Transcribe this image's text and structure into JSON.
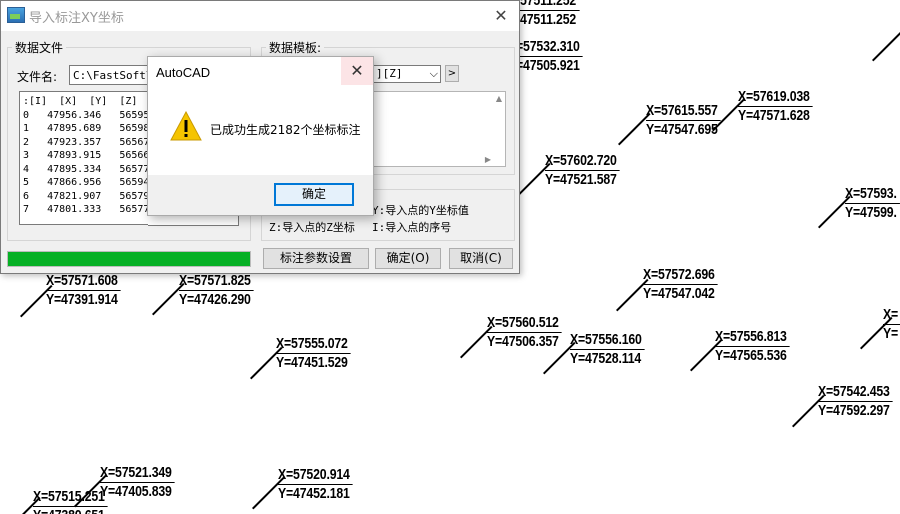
{
  "annotations": [
    {
      "x": "X=57511.252",
      "y": "Y=47511.252"
    },
    {
      "x": "X=57532.310",
      "y": "Y=47505.921"
    },
    {
      "x": "X=57615.557",
      "y": "Y=47547.695"
    },
    {
      "x": "X=57619.038",
      "y": "Y=47571.628"
    },
    {
      "x": "X=57602.720",
      "y": "Y=47521.587"
    },
    {
      "x": "X=57593.",
      "y": "Y=47599."
    },
    {
      "x": "X=57571.608",
      "y": "Y=47391.914"
    },
    {
      "x": "X=57571.825",
      "y": "Y=47426.290"
    },
    {
      "x": "X=57572.696",
      "y": "Y=47547.042"
    },
    {
      "x": "X=57560.512",
      "y": "Y=47506.357"
    },
    {
      "x": "X=57556.160",
      "y": "Y=47528.114"
    },
    {
      "x": "X=57556.813",
      "y": "Y=47565.536"
    },
    {
      "x": "X=",
      "y": "Y="
    },
    {
      "x": "X=57555.072",
      "y": "Y=47451.529"
    },
    {
      "x": "X=57542.453",
      "y": "Y=47592.297"
    },
    {
      "x": "X=57521.349",
      "y": "Y=47405.839"
    },
    {
      "x": "X=57520.914",
      "y": "Y=47452.181"
    },
    {
      "x": "X=57515.251",
      "y": "Y=47380.651"
    }
  ],
  "import_dialog": {
    "title": "导入标注XY坐标",
    "close_glyph": "✕",
    "data_file_legend": "数据文件",
    "file_name_label": "文件名:",
    "file_path": "C:\\FastSoft\\F",
    "data_lines": [
      ":[I]  [X]  [Y]  [Z]",
      "0   47956.346   56595.31",
      "1   47895.689   56598.86",
      "2   47923.357   56567.64",
      "3   47893.915   56566.22",
      "4   47895.334   56577.58",
      "5   47866.956   56594.96",
      "6   47821.907   56579.70",
      "7   47801.333   56577.225   211.500"
    ],
    "template_legend": "数据模板:",
    "template_value": "][Z]",
    "template_dropdown_glyph": "⌵",
    "template_arrow_glyph": ">",
    "hint_y": "Y:导入点的Y坐标值",
    "hint_z": "Z:导入点的Z坐标",
    "hint_i": "I:导入点的序号",
    "progress_fraction": 1.0,
    "btn_settings": "标注参数设置",
    "btn_ok": "确定(O)",
    "btn_cancel": "取消(C)"
  },
  "message_box": {
    "title": "AutoCAD",
    "close_glyph": "✕",
    "message": "已成功生成2182个坐标标注",
    "ok_label": "确定"
  },
  "colors": {
    "progress": "#06b025",
    "ok_border": "#0078d7",
    "warning": "#f5c400"
  }
}
